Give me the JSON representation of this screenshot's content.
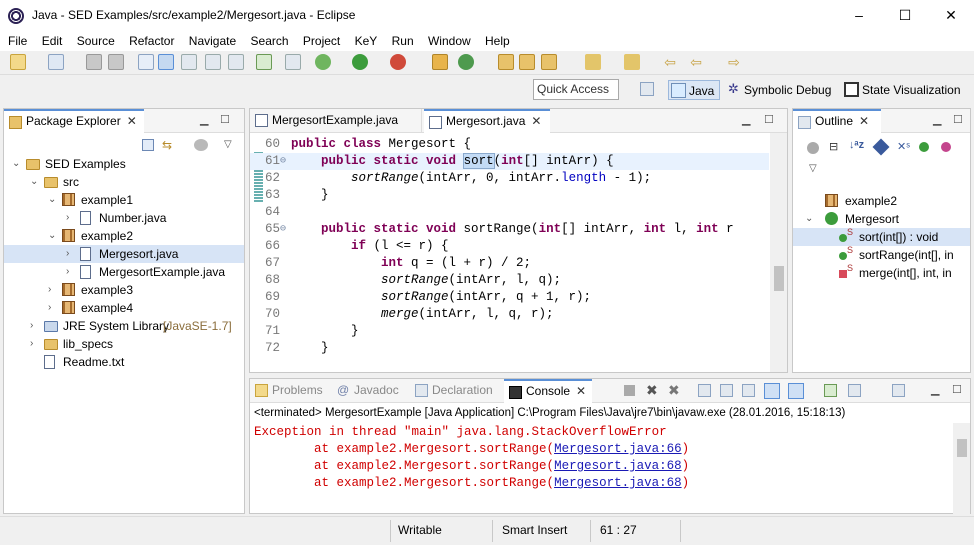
{
  "window": {
    "title": "Java - SED Examples/src/example2/Mergesort.java - Eclipse",
    "controls": [
      "–",
      "☐",
      "✕"
    ]
  },
  "menu": [
    "File",
    "Edit",
    "Source",
    "Refactor",
    "Navigate",
    "Search",
    "Project",
    "KeY",
    "Run",
    "Window",
    "Help"
  ],
  "quick_access": {
    "placeholder": "Quick Access"
  },
  "perspectives": [
    {
      "label": "Java",
      "icon": "java-perspective-icon",
      "active": true
    },
    {
      "label": "Symbolic Debug",
      "icon": "symbolic-debug-icon",
      "active": false
    },
    {
      "label": "State Visualization",
      "icon": "state-visualization-icon",
      "active": false
    }
  ],
  "package_explorer": {
    "tab": "Package Explorer",
    "tree": [
      {
        "label": "SED Examples",
        "depth": 0,
        "type": "project",
        "expanded": true
      },
      {
        "label": "src",
        "depth": 1,
        "type": "folder",
        "expanded": true
      },
      {
        "label": "example1",
        "depth": 2,
        "type": "package",
        "expanded": true
      },
      {
        "label": "Number.java",
        "depth": 3,
        "type": "java",
        "expanded": false
      },
      {
        "label": "example2",
        "depth": 2,
        "type": "package",
        "expanded": true
      },
      {
        "label": "Mergesort.java",
        "depth": 3,
        "type": "java",
        "expanded": false,
        "selected": true
      },
      {
        "label": "MergesortExample.java",
        "depth": 3,
        "type": "java",
        "expanded": false
      },
      {
        "label": "example3",
        "depth": 2,
        "type": "package",
        "expanded": false
      },
      {
        "label": "example4",
        "depth": 2,
        "type": "package",
        "expanded": false
      },
      {
        "label": "JRE System Library",
        "suffix": "[JavaSE-1.7]",
        "depth": 1,
        "type": "library",
        "expanded": false
      },
      {
        "label": "lib_specs",
        "depth": 1,
        "type": "folder",
        "expanded": false
      },
      {
        "label": "Readme.txt",
        "depth": 1,
        "type": "text",
        "leaf": true
      }
    ]
  },
  "editor": {
    "tabs": [
      {
        "label": "MergesortExample.java",
        "active": false
      },
      {
        "label": "Mergesort.java",
        "active": true
      }
    ],
    "lines": [
      {
        "n": "60",
        "html": "<span class='kw'>public class</span> Mergesort {"
      },
      {
        "n": "61",
        "html": "    <span class='kw'>public static void</span> <span class='occ'>sort</span>(<span class='kw'>int</span>[] intArr) {",
        "current": true
      },
      {
        "n": "62",
        "html": "        <span class='it'>sortRange</span>(intArr, 0, intArr.<span class='fld'>length</span> - 1);"
      },
      {
        "n": "63",
        "html": "    }"
      },
      {
        "n": "64",
        "html": ""
      },
      {
        "n": "65",
        "html": "    <span class='kw'>public static void</span> sortRange(<span class='kw'>int</span>[] intArr, <span class='kw'>int</span> l, <span class='kw'>int</span> r"
      },
      {
        "n": "66",
        "html": "        <span class='kw'>if</span> (l &lt;= r) {"
      },
      {
        "n": "67",
        "html": "            <span class='kw'>int</span> q = (l + r) / 2;"
      },
      {
        "n": "68",
        "html": "            <span class='it'>sortRange</span>(intArr, l, q);"
      },
      {
        "n": "69",
        "html": "            <span class='it'>sortRange</span>(intArr, q + 1, r);"
      },
      {
        "n": "70",
        "html": "            <span class='it'>merge</span>(intArr, l, q, r);"
      },
      {
        "n": "71",
        "html": "        }"
      },
      {
        "n": "72",
        "html": "    }"
      }
    ]
  },
  "outline": {
    "tab": "Outline",
    "items": [
      {
        "label": "example2",
        "depth": 0,
        "type": "package"
      },
      {
        "label": "Mergesort",
        "depth": 0,
        "type": "class",
        "expanded": true
      },
      {
        "label": "sort(int[]) : void",
        "depth": 1,
        "type": "public-static-method",
        "selected": true
      },
      {
        "label": "sortRange(int[], in",
        "depth": 1,
        "type": "public-static-method"
      },
      {
        "label": "merge(int[], int, in",
        "depth": 1,
        "type": "private-static-method"
      }
    ]
  },
  "bottom_panel": {
    "tabs": [
      {
        "label": "Problems",
        "active": false
      },
      {
        "label": "Javadoc",
        "active": false
      },
      {
        "label": "Declaration",
        "active": false
      },
      {
        "label": "Console",
        "active": true
      }
    ],
    "header": "<terminated> MergesortExample [Java Application] C:\\Program Files\\Java\\jre7\\bin\\javaw.exe (28.01.2016, 15:18:13)",
    "lines": [
      {
        "text": "Exception in thread \"main\" java.lang.StackOverflowError",
        "link": ""
      },
      {
        "text": "        at example2.Mergesort.sortRange(",
        "link": "Mergesort.java:66",
        "tail": ")"
      },
      {
        "text": "        at example2.Mergesort.sortRange(",
        "link": "Mergesort.java:68",
        "tail": ")"
      },
      {
        "text": "        at example2.Mergesort.sortRange(",
        "link": "Mergesort.java:68",
        "tail": ")"
      }
    ]
  },
  "status_bar": {
    "mode": "Writable",
    "insert": "Smart Insert",
    "position": "61 : 27"
  }
}
